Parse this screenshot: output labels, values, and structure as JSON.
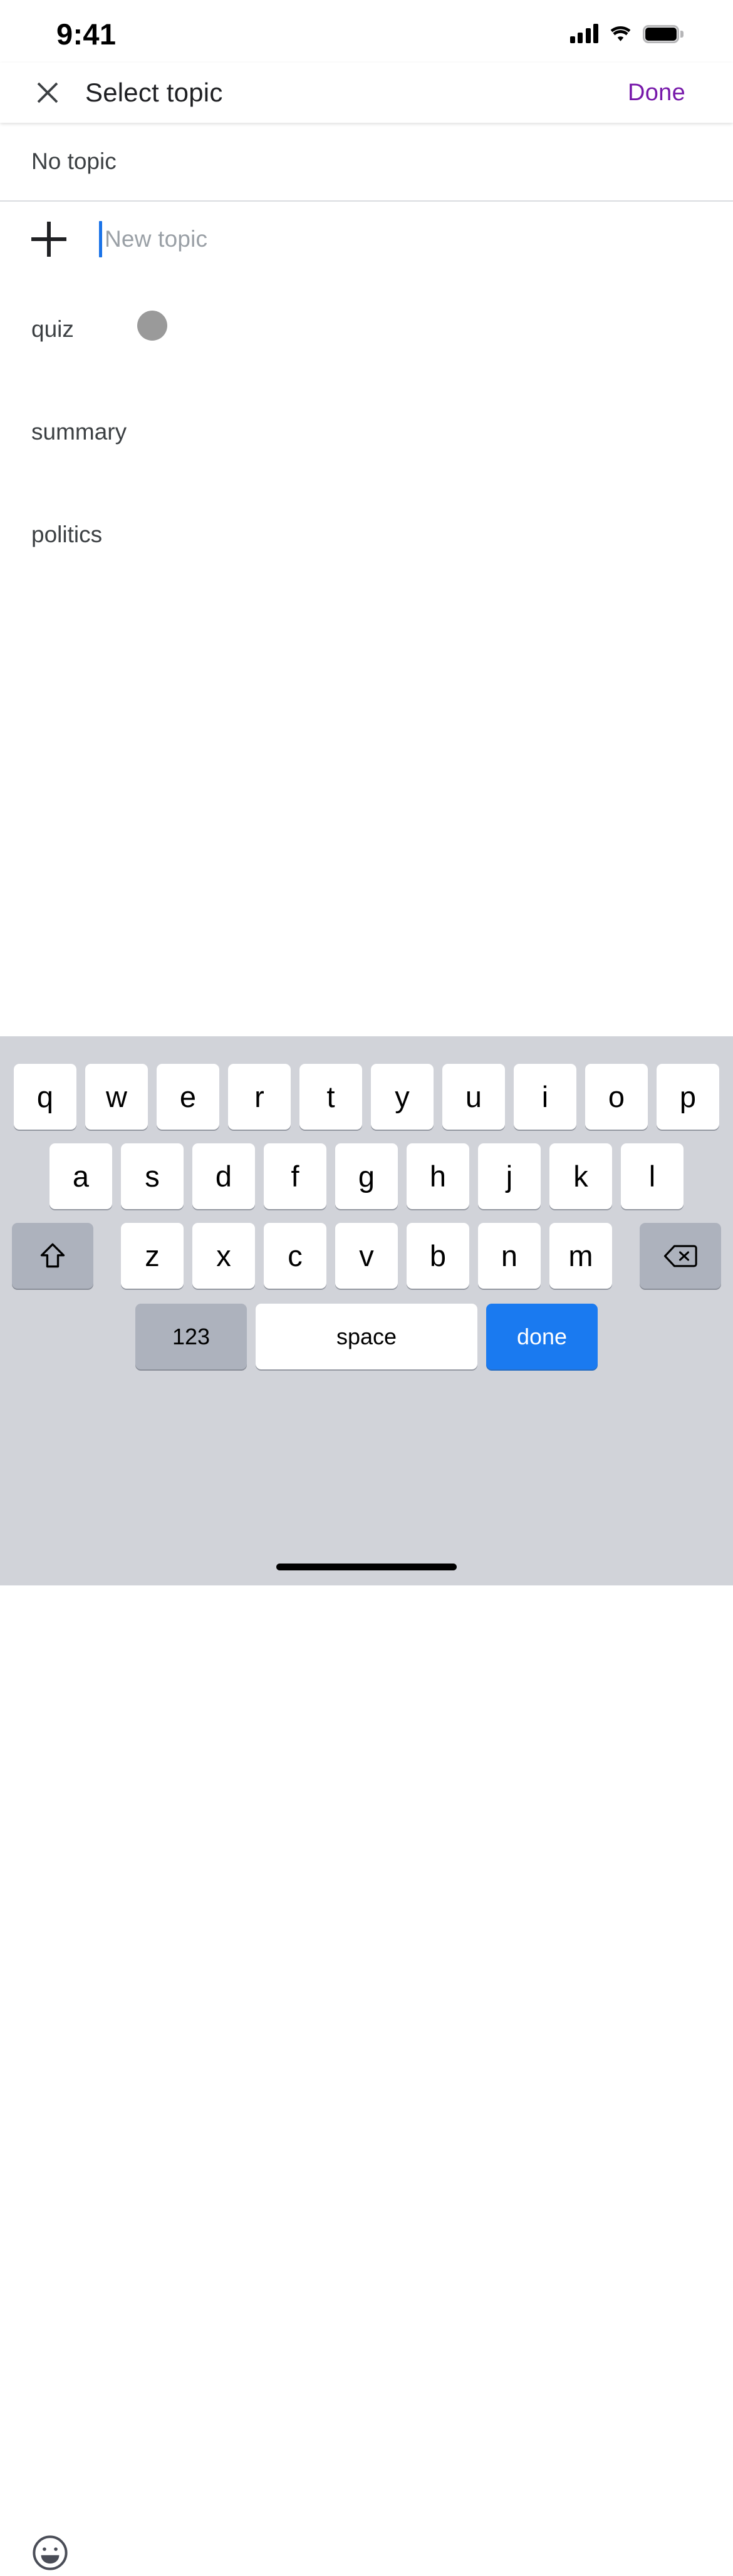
{
  "status_bar": {
    "time": "9:41",
    "signal_icon": "cellular-signal-icon",
    "wifi_icon": "wifi-icon",
    "battery_icon": "battery-full-icon",
    "battery_level": 100
  },
  "header": {
    "close_icon": "close-icon",
    "title": "Select topic",
    "done_label": "Done",
    "done_color": "#7719aa"
  },
  "list": {
    "no_topic_label": "No topic",
    "new_topic": {
      "add_icon": "plus-icon",
      "placeholder": "New topic",
      "value": "",
      "caret_color": "#1a73e8"
    },
    "topics": [
      {
        "label": "quiz"
      },
      {
        "label": "summary"
      },
      {
        "label": "politics"
      }
    ]
  },
  "touch_indicator": {
    "name": "touch-point",
    "color": "#9a9a9a"
  },
  "keyboard": {
    "background": "#d1d3d9",
    "row1": [
      "q",
      "w",
      "e",
      "r",
      "t",
      "y",
      "u",
      "i",
      "o",
      "p"
    ],
    "row2": [
      "a",
      "s",
      "d",
      "f",
      "g",
      "h",
      "j",
      "k",
      "l"
    ],
    "row3": [
      "z",
      "x",
      "c",
      "v",
      "b",
      "n",
      "m"
    ],
    "shift_icon": "shift-icon",
    "backspace_icon": "backspace-icon",
    "numbers_label": "123",
    "space_label": "space",
    "done_label": "done",
    "done_key_color": "#1a7af0",
    "emoji_icon": "emoji-smiley-icon"
  },
  "home_indicator": {
    "name": "home-indicator"
  }
}
